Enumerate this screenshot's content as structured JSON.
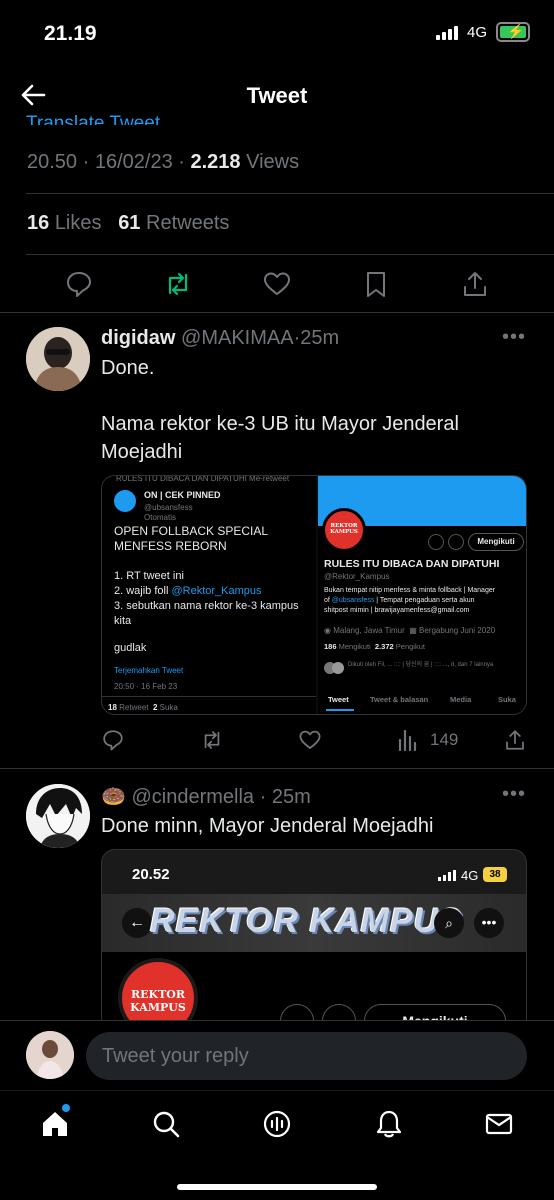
{
  "status_bar": {
    "time": "21.19",
    "network": "4G"
  },
  "header": {
    "title": "Tweet"
  },
  "tweet": {
    "translate_label": "Translate Tweet",
    "time": "20.50",
    "date": "16/02/23",
    "views_count": "2.218",
    "views_label": "Views",
    "likes_count": "16",
    "likes_label": "Likes",
    "retweets_count": "61",
    "retweets_label": "Retweets",
    "colors": {
      "retweet": "#00ba7c",
      "link": "#1d9bf0"
    }
  },
  "replies": [
    {
      "display_name": "digidaw",
      "handle": "@MAKIMAA",
      "age": "25m",
      "text_line1": "Done.",
      "text_line2": "Nama rektor ke-3 UB itu Mayor Jenderal Moejadhi",
      "views": "149",
      "image": {
        "left_header": "RULES ITU DIBACA DAN DIPATUHI Me-retweet",
        "account_name": "ON | CEK PINNED",
        "account_handle": "@ubsansfess",
        "automated": "Otomatis",
        "tweet_line1": "OPEN FOLLBACK SPECIAL",
        "tweet_line2": "MENFESS REBORN",
        "item1": "1. RT tweet ini",
        "item2_prefix": "2. wajib foll ",
        "item2_link": "@Rektor_Kampus",
        "item3": "3. sebutkan nama rektor ke-3 kampus kita",
        "gudlak": "gudlak",
        "translate": "Terjemahkan Tweet",
        "timestamp": "20:50 · 16 Feb 23",
        "retweet_count": "18",
        "retweet_label": "Retweet",
        "suka_count": "2",
        "suka_label": "Suka",
        "profile_logo_line1": "REKTOR",
        "profile_logo_line2": "KAMPUS",
        "follow_button": "Mengikuti",
        "profile_name": "RULES ITU DIBACA DAN DIPATUHI",
        "profile_handle": "@Rektor_Kampus",
        "bio_line1": "Bukan tempat nitip menfess & minta follback | Manager",
        "bio_line2_prefix": "of ",
        "bio_line2_link": "@ubsansfess",
        "bio_line2_rest": " | Tempat pengaduan serta akun",
        "bio_line3": "shitpost mimin | brawijayamenfess@gmail.com",
        "location": "Malang, Jawa Timur",
        "joined": "Bergabung Juni 2020",
        "following_count": "186",
        "following_label": "Mengikuti",
        "followers_count": "2.372",
        "followers_label": "Pengikut",
        "followed_by": "Dikuti oleh Fil, ... :::: | 당신의 꿈 | :::: ..., d, dan 7 lainnya",
        "tabs": [
          "Tweet",
          "Tweet & balasan",
          "Media",
          "Suka"
        ]
      }
    },
    {
      "emoji": "🍩",
      "handle": "@cindermella",
      "age": "25m",
      "text": "Done minn, Mayor Jenderal Moejadhi",
      "image": {
        "time": "20.52",
        "network": "4G",
        "battery": "38",
        "banner_text": "REKTOR KAMPUS",
        "logo_line1": "REKTOR",
        "logo_line2": "KAMPUS",
        "follow_button": "Mengikuti"
      }
    }
  ],
  "composer": {
    "placeholder": "Tweet your reply"
  }
}
